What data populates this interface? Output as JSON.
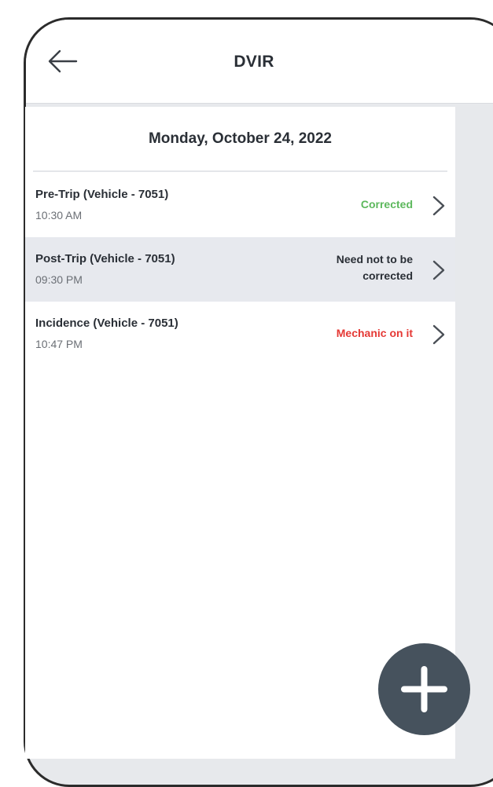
{
  "header": {
    "title": "DVIR",
    "back_icon": "arrow-left-icon"
  },
  "date_heading": "Monday, October 24, 2022",
  "inspections": [
    {
      "title": "Pre-Trip (Vehicle - 7051)",
      "time": "10:30 AM",
      "status": "Corrected",
      "status_color": "#5cb85c",
      "selected": false
    },
    {
      "title": "Post-Trip (Vehicle - 7051)",
      "time": "09:30 PM",
      "status": "Need not to be corrected",
      "status_color": "#2a2f36",
      "selected": true
    },
    {
      "title": "Incidence (Vehicle - 7051)",
      "time": "10:47 PM",
      "status": "Mechanic on it",
      "status_color": "#e53935",
      "selected": false
    }
  ],
  "fab": {
    "icon": "plus-icon",
    "color": "#46525d"
  }
}
